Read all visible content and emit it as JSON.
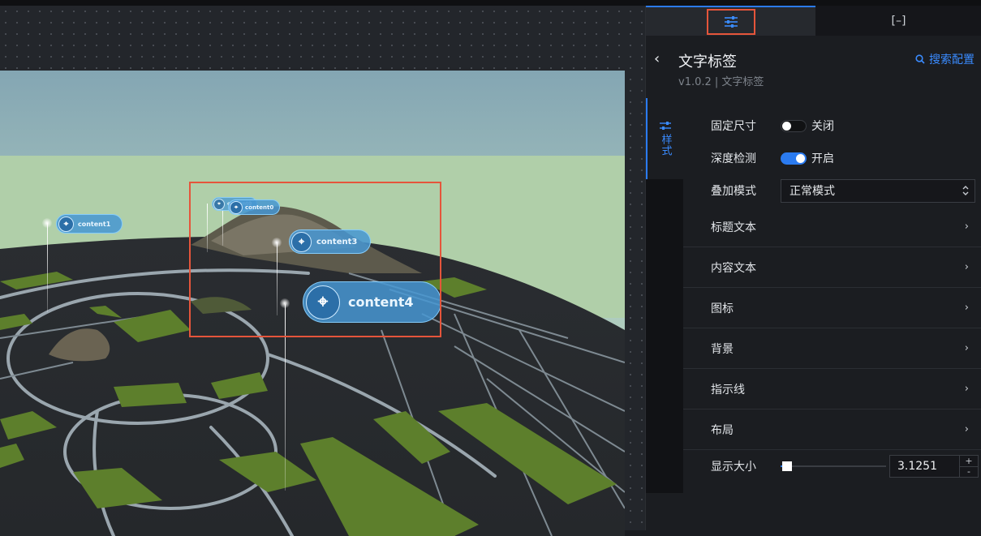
{
  "canvas": {
    "labels": [
      "content1",
      "content0",
      "content3",
      "content4"
    ],
    "label_sixth": "content0"
  },
  "panel": {
    "tabs": [
      {
        "name": "style-settings",
        "icon": "sliders-icon",
        "active": true
      },
      {
        "name": "data-panel",
        "label": "[–]",
        "active": false
      }
    ],
    "title": "文字标签",
    "subtitle": "v1.0.2 | 文字标签",
    "search_label": "搜索配置",
    "side_tab": "样式",
    "fields": {
      "fixed_size": {
        "label": "固定尺寸",
        "on": false,
        "state_text": "关闭"
      },
      "depth_test": {
        "label": "深度检测",
        "on": true,
        "state_text": "开启"
      },
      "blend_mode": {
        "label": "叠加模式",
        "value": "正常模式"
      }
    },
    "sections": [
      "标题文本",
      "内容文本",
      "图标",
      "背景",
      "指示线",
      "布局"
    ],
    "display_size": {
      "label": "显示大小",
      "value": "3.1251",
      "slider_fraction": 0.02,
      "plus": "+",
      "minus": "-"
    }
  },
  "colors": {
    "accent": "#2b7bf0",
    "highlight": "#e5553b"
  }
}
